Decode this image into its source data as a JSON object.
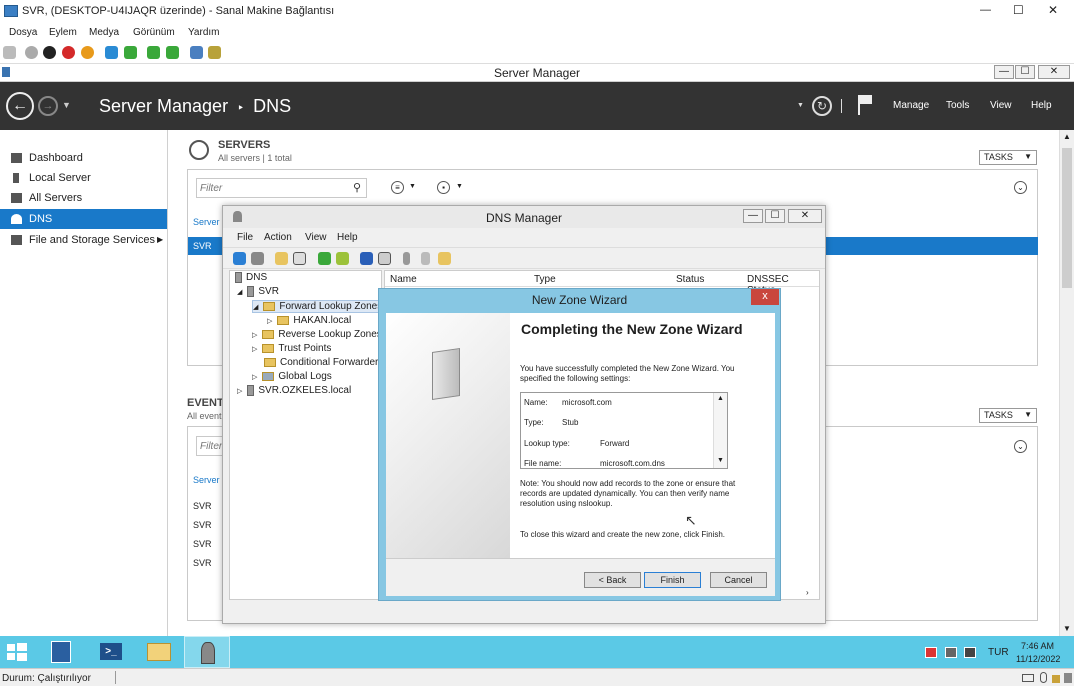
{
  "vm": {
    "title": "SVR, (DESKTOP-U4IJAQR üzerinde) - Sanal Makine Bağlantısı",
    "menu": [
      "Dosya",
      "Eylem",
      "Medya",
      "Görünüm",
      "Yardım"
    ],
    "minimize": "—",
    "maximize": "☐",
    "close": "✕"
  },
  "sm": {
    "title": "Server Manager",
    "breadcrumb_root": "Server Manager",
    "breadcrumb_sep": "‣",
    "breadcrumb_page": "DNS",
    "menu": {
      "manage": "Manage",
      "tools": "Tools",
      "view": "View",
      "help": "Help"
    },
    "nav": [
      {
        "label": "Dashboard"
      },
      {
        "label": "Local Server"
      },
      {
        "label": "All Servers"
      },
      {
        "label": "DNS"
      },
      {
        "label": "File and Storage Services"
      }
    ],
    "servers": {
      "heading": "SERVERS",
      "sub": "All servers | 1 total",
      "tasks": "TASKS",
      "filter_placeholder": "Filter",
      "col_server": "Server",
      "row_server": "SVR"
    },
    "events": {
      "heading": "EVENTS",
      "sub": "All event",
      "tasks": "TASKS",
      "filter_placeholder": "Filter",
      "col_server": "Server",
      "rows": [
        "SVR",
        "SVR",
        "SVR",
        "SVR"
      ]
    }
  },
  "dns": {
    "title": "DNS Manager",
    "menu": [
      "File",
      "Action",
      "View",
      "Help"
    ],
    "columns": [
      "Name",
      "Type",
      "Status",
      "DNSSEC Status"
    ],
    "tree": {
      "root": "DNS",
      "server": "SVR",
      "fwd": "Forward Lookup Zones",
      "hakan": "HAKAN.local",
      "rev": "Reverse Lookup Zones",
      "trust": "Trust Points",
      "cond": "Conditional Forwarders",
      "logs": "Global Logs",
      "server2": "SVR.OZKELES.local"
    }
  },
  "wizard": {
    "title": "New Zone Wizard",
    "close": "x",
    "heading": "Completing the New Zone Wizard",
    "intro": "You have successfully completed the New Zone Wizard. You specified the following settings:",
    "settings": [
      {
        "k": "Name:",
        "v": "microsoft.com"
      },
      {
        "k": "Type:",
        "v": "Stub"
      },
      {
        "k": "Lookup type:",
        "v": "Forward"
      },
      {
        "k": "File name:",
        "v": "microsoft.com.dns"
      }
    ],
    "note": "Note: You should now add records to the zone or ensure that records are updated dynamically. You can then verify name resolution using nslookup.",
    "closing": "To close this wizard and create the new zone, click Finish.",
    "back": "< Back",
    "finish": "Finish",
    "cancel": "Cancel"
  },
  "taskbar": {
    "lang": "TUR",
    "time": "7:46 AM",
    "date": "11/12/2022"
  },
  "status": {
    "text": "Durum: Çalıştırılıyor"
  }
}
